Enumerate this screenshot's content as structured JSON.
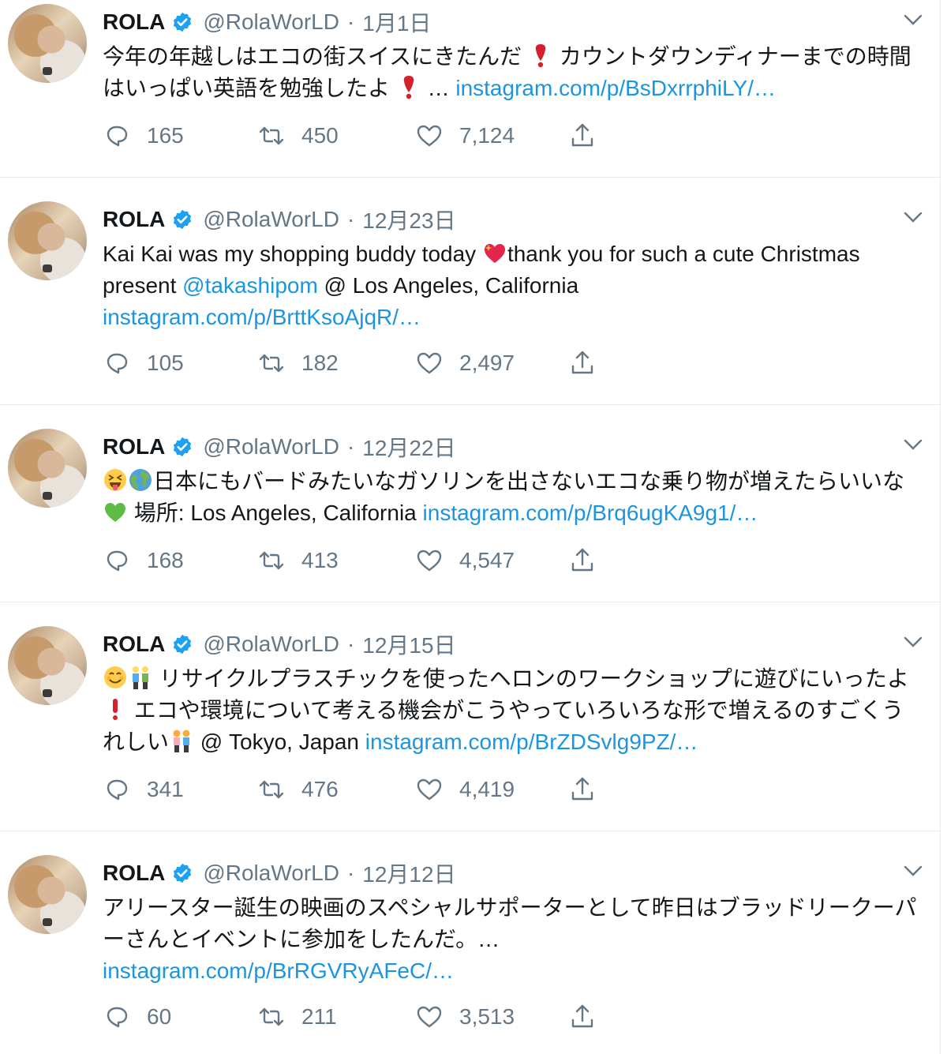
{
  "account": {
    "name": "ROLA",
    "handle": "@RolaWorLD",
    "separator": "·"
  },
  "tweets": [
    {
      "date": "1月1日",
      "text_a": "今年の年越しはエコの街スイスにきたんだ",
      "text_b": "カウントダウンディナーまでの時間はいっぱい英語を勉強したよ",
      "text_c": "… ",
      "link": "instagram.com/p/BsDxrrphiLY/…",
      "replies": "165",
      "retweets": "450",
      "likes": "7,124"
    },
    {
      "date": "12月23日",
      "text_a": "Kai Kai was my shopping buddy today ",
      "text_b": "thank you for such a cute Christmas present ",
      "mention": "@takashipom",
      "text_c": " @ Los Angeles, California",
      "link": "instagram.com/p/BrttKsoAjqR/…",
      "replies": "105",
      "retweets": "182",
      "likes": "2,497"
    },
    {
      "date": "12月22日",
      "text_a": "日本にもバードみたいなガソリンを出さないエコな乗り物が増えたらいいな",
      "text_b": " 場所: Los Angeles, California ",
      "link": "instagram.com/p/Brq6ugKA9g1/…",
      "replies": "168",
      "retweets": "413",
      "likes": "4,547"
    },
    {
      "date": "12月15日",
      "text_a": " リサイクルプラスチックを使ったヘロンのワークショップに遊びにいったよ",
      "text_b": " エコや環境について考える機会がこうやっていろいろな形で増えるのすごくうれしい",
      "text_c": " @ Tokyo, Japan ",
      "link": "instagram.com/p/BrZDSvlg9PZ/…",
      "replies": "341",
      "retweets": "476",
      "likes": "4,419"
    },
    {
      "date": "12月12日",
      "text_a": "アリースター誕生の映画のスペシャルサポーターとして昨日はブラッドリークーパーさんとイベントに参加をしたんだ。…",
      "link": "instagram.com/p/BrRGVRyAFeC/…",
      "replies": "60",
      "retweets": "211",
      "likes": "3,513"
    }
  ],
  "colors": {
    "link": "#1b95e0",
    "muted": "#657786",
    "verified": "#1da1f2",
    "divider": "#e6ecf0"
  },
  "icons": [
    "reply-icon",
    "retweet-icon",
    "like-icon",
    "share-icon",
    "verified-badge-icon",
    "chevron-down-icon"
  ]
}
